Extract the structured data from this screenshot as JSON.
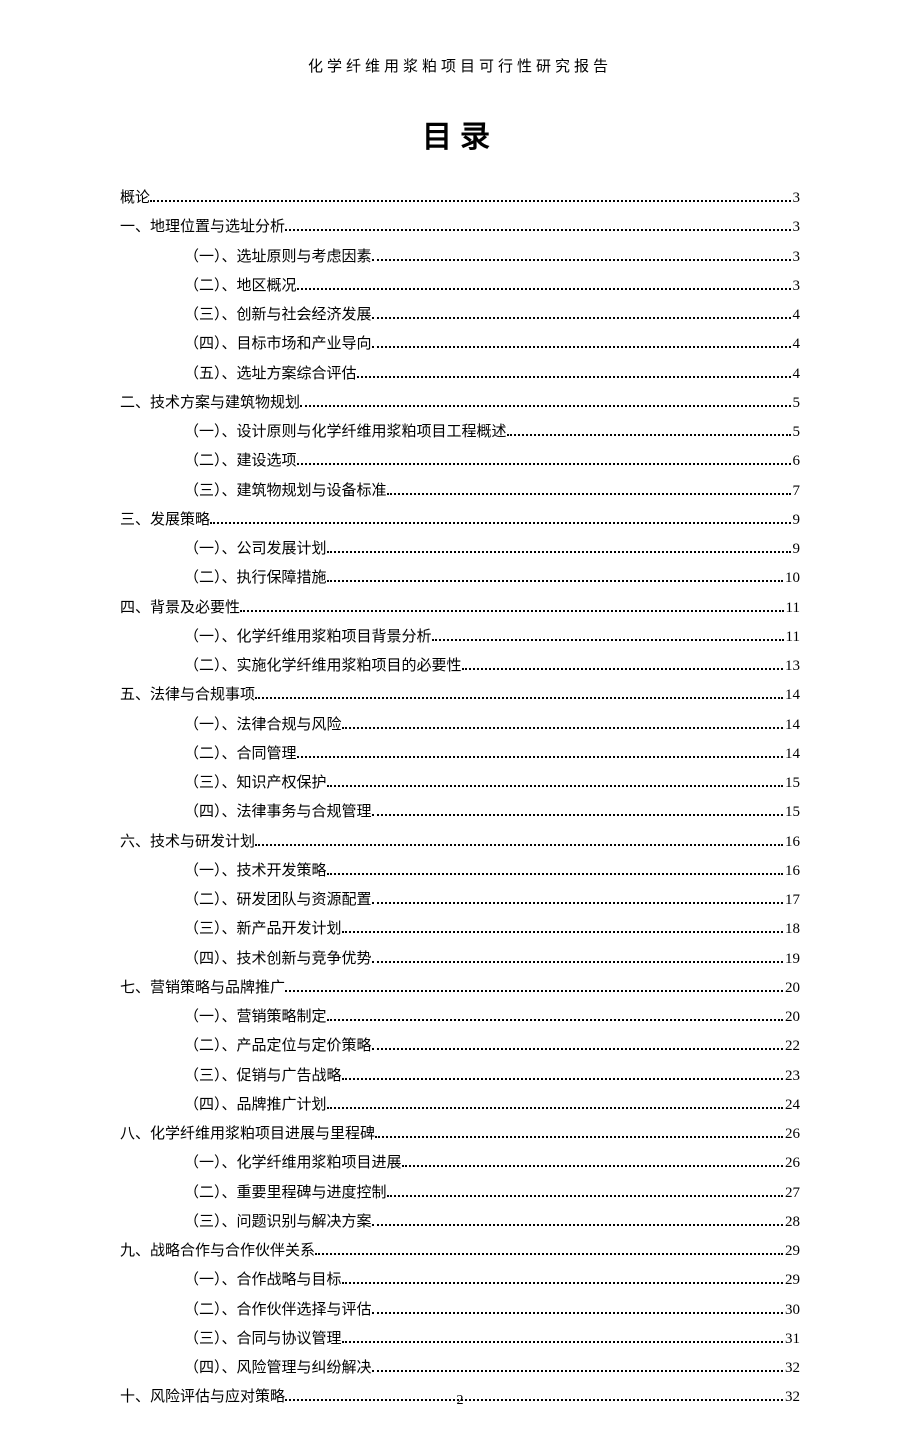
{
  "header": "化学纤维用浆粕项目可行性研究报告",
  "title": "目录",
  "page_number": "2",
  "toc": [
    {
      "level": 1,
      "label": "概论",
      "page": "3"
    },
    {
      "level": 1,
      "label": "一、地理位置与选址分析",
      "page": "3"
    },
    {
      "level": 2,
      "label": "（一）、选址原则与考虑因素",
      "page": "3"
    },
    {
      "level": 2,
      "label": "（二）、地区概况",
      "page": "3"
    },
    {
      "level": 2,
      "label": "（三）、创新与社会经济发展",
      "page": "4"
    },
    {
      "level": 2,
      "label": "（四）、目标市场和产业导向",
      "page": "4"
    },
    {
      "level": 2,
      "label": "（五）、选址方案综合评估",
      "page": "4"
    },
    {
      "level": 1,
      "label": "二、技术方案与建筑物规划",
      "page": "5"
    },
    {
      "level": 2,
      "label": "（一）、设计原则与化学纤维用浆粕项目工程概述",
      "page": "5"
    },
    {
      "level": 2,
      "label": "（二）、建设选项",
      "page": "6"
    },
    {
      "level": 2,
      "label": "（三）、建筑物规划与设备标准",
      "page": "7"
    },
    {
      "level": 1,
      "label": "三、发展策略",
      "page": "9"
    },
    {
      "level": 2,
      "label": "（一）、公司发展计划",
      "page": "9"
    },
    {
      "level": 2,
      "label": "（二）、执行保障措施",
      "page": "10"
    },
    {
      "level": 1,
      "label": "四、背景及必要性",
      "page": "11"
    },
    {
      "level": 2,
      "label": "（一）、化学纤维用浆粕项目背景分析",
      "page": "11"
    },
    {
      "level": 2,
      "label": "（二）、实施化学纤维用浆粕项目的必要性",
      "page": "13"
    },
    {
      "level": 1,
      "label": "五、法律与合规事项",
      "page": "14"
    },
    {
      "level": 2,
      "label": "（一）、法律合规与风险",
      "page": "14"
    },
    {
      "level": 2,
      "label": "（二）、合同管理",
      "page": "14"
    },
    {
      "level": 2,
      "label": "（三）、知识产权保护",
      "page": "15"
    },
    {
      "level": 2,
      "label": "（四）、法律事务与合规管理",
      "page": "15"
    },
    {
      "level": 1,
      "label": "六、技术与研发计划",
      "page": "16"
    },
    {
      "level": 2,
      "label": "（一）、技术开发策略",
      "page": "16"
    },
    {
      "level": 2,
      "label": "（二）、研发团队与资源配置",
      "page": "17"
    },
    {
      "level": 2,
      "label": "（三）、新产品开发计划",
      "page": "18"
    },
    {
      "level": 2,
      "label": "（四）、技术创新与竞争优势",
      "page": "19"
    },
    {
      "level": 1,
      "label": "七、营销策略与品牌推广",
      "page": "20"
    },
    {
      "level": 2,
      "label": "（一）、营销策略制定",
      "page": "20"
    },
    {
      "level": 2,
      "label": "（二）、产品定位与定价策略",
      "page": "22"
    },
    {
      "level": 2,
      "label": "（三）、促销与广告战略",
      "page": "23"
    },
    {
      "level": 2,
      "label": "（四）、品牌推广计划",
      "page": "24"
    },
    {
      "level": 1,
      "label": "八、化学纤维用浆粕项目进展与里程碑",
      "page": "26"
    },
    {
      "level": 2,
      "label": "（一）、化学纤维用浆粕项目进展",
      "page": "26"
    },
    {
      "level": 2,
      "label": "（二）、重要里程碑与进度控制",
      "page": "27"
    },
    {
      "level": 2,
      "label": "（三）、问题识别与解决方案",
      "page": "28"
    },
    {
      "level": 1,
      "label": "九、战略合作与合作伙伴关系",
      "page": "29"
    },
    {
      "level": 2,
      "label": "（一）、合作战略与目标",
      "page": "29"
    },
    {
      "level": 2,
      "label": "（二）、合作伙伴选择与评估",
      "page": "30"
    },
    {
      "level": 2,
      "label": "（三）、合同与协议管理",
      "page": "31"
    },
    {
      "level": 2,
      "label": "（四）、风险管理与纠纷解决",
      "page": "32"
    },
    {
      "level": 1,
      "label": "十、风险评估与应对策略",
      "page": "32"
    }
  ]
}
